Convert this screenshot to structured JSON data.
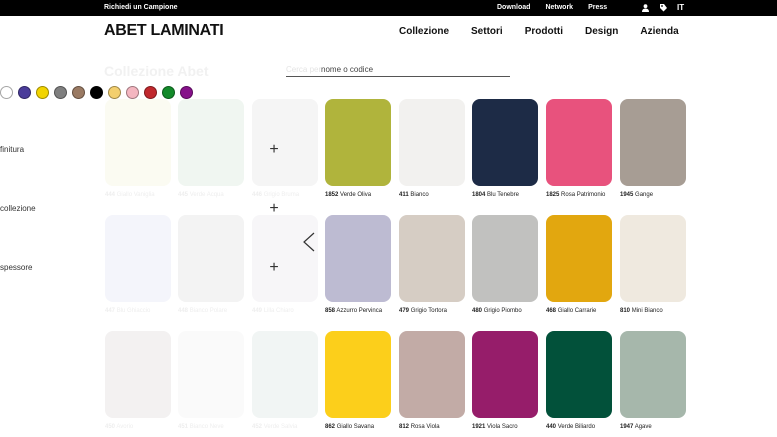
{
  "topbar": {
    "request_sample": "Richiedi un Campione",
    "links": [
      "Download",
      "Network",
      "Press"
    ],
    "lang": "IT",
    "icons": [
      "user-icon",
      "tag-icon"
    ]
  },
  "header": {
    "logo": "ABET LAMINATI",
    "nav": [
      "Collezione",
      "Settori",
      "Prodotti",
      "Design",
      "Azienda"
    ]
  },
  "page": {
    "title": "Collezione Abet",
    "search_ghost": "Cerca per",
    "search_placeholder": "nome o codice"
  },
  "color_filters": [
    "#ffffff",
    "#4a3c9a",
    "#f2d400",
    "#7f7f7f",
    "#9a7a63",
    "#000000",
    "#f3cf6e",
    "#f4b6c0",
    "#c0282d",
    "#138a2a",
    "#86118a"
  ],
  "filters": [
    "finitura",
    "collezione",
    "spessore"
  ],
  "faded_swatches": [
    {
      "color": "#fbfbf2",
      "code": "444",
      "name": "Giallo Vaniglia"
    },
    {
      "color": "#f0f6f1",
      "code": "445",
      "name": "Verde Acqua"
    },
    {
      "color": "#f5f5f5",
      "code": "446",
      "name": "Grigio Bruma"
    },
    {
      "color": "#f4f5fb",
      "code": "447",
      "name": "Blu Ghiaccio"
    },
    {
      "color": "#f3f3f3",
      "code": "448",
      "name": "Bianco Polare"
    },
    {
      "color": "#f7f6f8",
      "code": "449",
      "name": "Lilla Chiaro"
    },
    {
      "color": "#f3f1f1",
      "code": "450",
      "name": "Avorio"
    },
    {
      "color": "#fafafa",
      "code": "451",
      "name": "Bianco Neve"
    },
    {
      "color": "#f1f5f4",
      "code": "452",
      "name": "Verde Salvia"
    }
  ],
  "swatches": [
    {
      "color": "#b0b43c",
      "code": "1852",
      "name": "Verde Oliva"
    },
    {
      "color": "#f2f1ef",
      "code": "411",
      "name": "Bianco"
    },
    {
      "color": "#1d2b46",
      "code": "1804",
      "name": "Blu Tenebre"
    },
    {
      "color": "#e8527d",
      "code": "1825",
      "name": "Rosa Patrimonio"
    },
    {
      "color": "#a79d94",
      "code": "1945",
      "name": "Gange"
    },
    {
      "color": "#bdbbd2",
      "code": "858",
      "name": "Azzurro Pervinca"
    },
    {
      "color": "#d6cdc4",
      "code": "479",
      "name": "Grigio Tortora"
    },
    {
      "color": "#c1c1bf",
      "code": "480",
      "name": "Grigio Piombo"
    },
    {
      "color": "#e2a70f",
      "code": "468",
      "name": "Giallo Carrarie"
    },
    {
      "color": "#efe9df",
      "code": "810",
      "name": "Mini Bianco"
    },
    {
      "color": "#fccf1b",
      "code": "862",
      "name": "Giallo Savana"
    },
    {
      "color": "#c2aba6",
      "code": "812",
      "name": "Rosa Viola"
    },
    {
      "color": "#961d6a",
      "code": "1921",
      "name": "Viola Sacro"
    },
    {
      "color": "#02513a",
      "code": "440",
      "name": "Verde Biliardo"
    },
    {
      "color": "#a6b7ab",
      "code": "1947",
      "name": "Agave"
    }
  ]
}
